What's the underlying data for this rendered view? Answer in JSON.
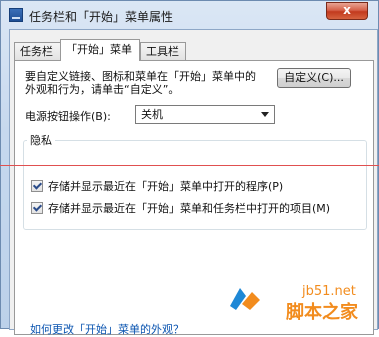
{
  "window": {
    "title": "任务栏和「开始」菜单属性",
    "close_label": "x"
  },
  "tabs": [
    {
      "label": "任务栏"
    },
    {
      "label": "「开始」菜单"
    },
    {
      "label": "工具栏"
    }
  ],
  "start_menu": {
    "description_line1": "要自定义链接、图标和菜单在「开始」菜单中的",
    "description_line2": "外观和行为，请单击“自定义”。",
    "customize_button": "自定义(C)...",
    "power_button_label": "电源按钮操作(B):",
    "power_button_value": "关机"
  },
  "privacy": {
    "title": "隐私",
    "items": [
      {
        "label": "存储并显示最近在「开始」菜单中打开的程序(P)",
        "checked": true
      },
      {
        "label": "存储并显示最近在「开始」菜单和任务栏中打开的项目(M)",
        "checked": true
      }
    ]
  },
  "bottom_link": "如何更改「开始」菜单的外观？",
  "watermark": {
    "site": "jb51.net",
    "name": "脚本之家"
  },
  "colors": {
    "accent": "#f28c1e",
    "title_close": "#c23a1e",
    "red_line": "#e05050"
  }
}
